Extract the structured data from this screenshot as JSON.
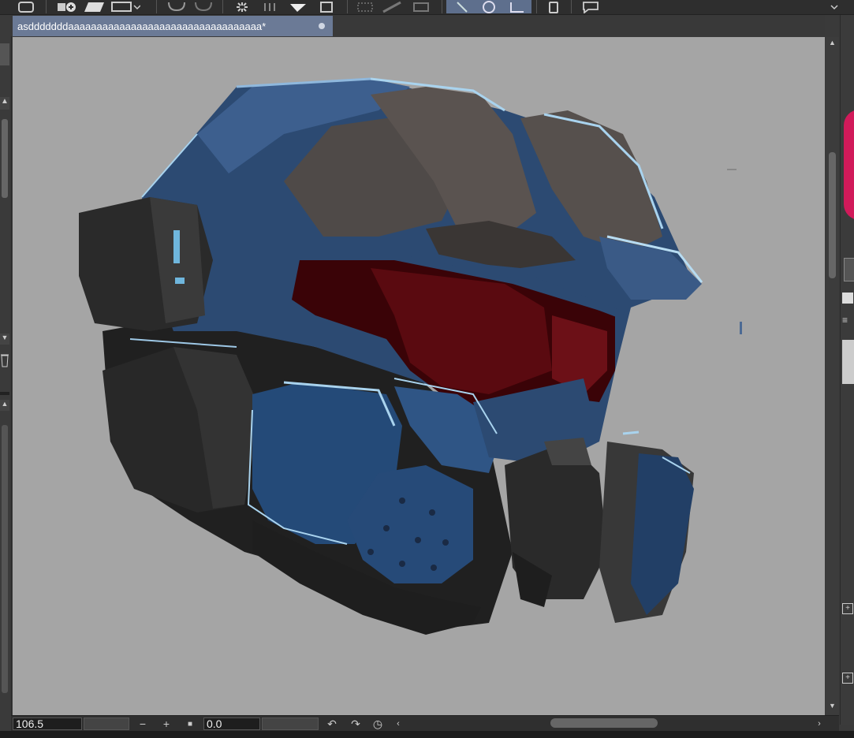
{
  "document_tab": {
    "title": "asdddddddaaaaaaaaaaaaaaaaaaaaaaaaaaaaaaaaaa*"
  },
  "status": {
    "zoom": "106.5",
    "rotation": "0.0",
    "zoom_out": "−",
    "zoom_in": "+",
    "fit": "■"
  },
  "canvas": {
    "background": "#a5a5a5",
    "artwork": "helmet-painting"
  },
  "colors": {
    "tab_active": "#6b7a96",
    "helmet_blue": "#2e4d78",
    "visor_red": "#5a0a10",
    "highlight": "#a9d3ee"
  }
}
